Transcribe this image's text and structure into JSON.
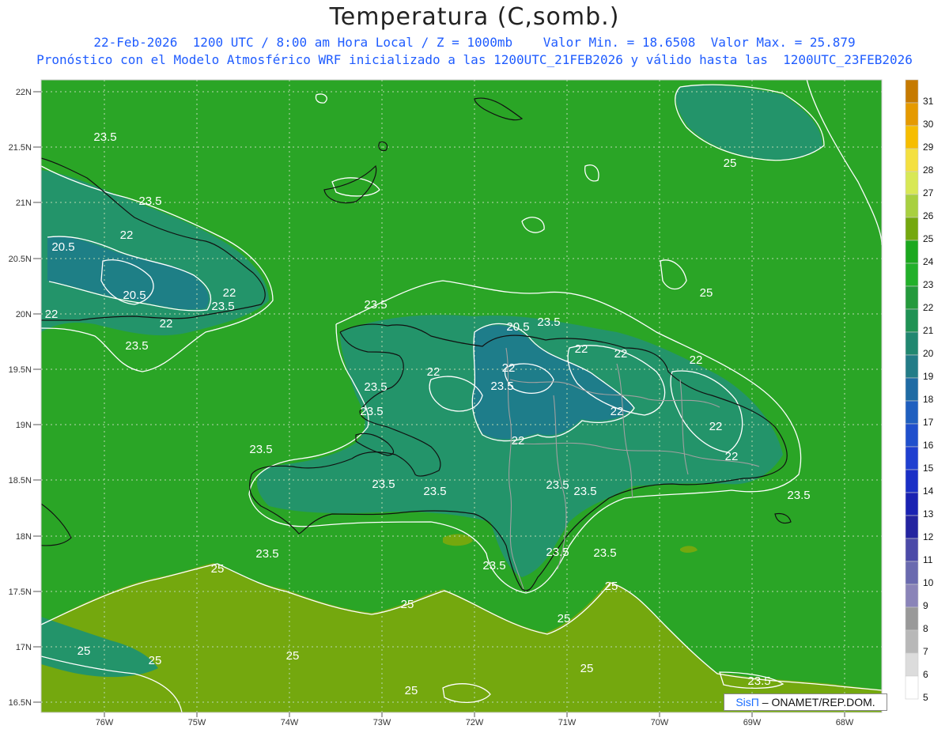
{
  "header": {
    "title": "Temperatura (C,somb.)",
    "line1": "22-Feb-2026  1200 UTC / 8:00 am Hora Local / Z = 1000mb    Valor Min. = 18.6508  Valor Max. = 25.879",
    "line2": "Pronóstico con el Modelo Atmosférico WRF inicializado a las 1200UTC_21FEB2026 y válido hasta las  1200UTC_23FEB2026"
  },
  "axes": {
    "lat_labels": [
      "22N",
      "21.5N",
      "21N",
      "20.5N",
      "20N",
      "19.5N",
      "19N",
      "18.5N",
      "18N",
      "17.5N",
      "17N",
      "16.5N"
    ],
    "lon_labels": [
      "76W",
      "75W",
      "74W",
      "73W",
      "72W",
      "71W",
      "70W",
      "69W",
      "68W"
    ]
  },
  "contour_labels": [
    "23.5",
    "23.5",
    "22",
    "20.5",
    "20.5",
    "22",
    "22",
    "23.5",
    "22",
    "23.5",
    "23.5",
    "20.5",
    "23.5",
    "22",
    "22",
    "22",
    "23.5",
    "22",
    "22",
    "23.5",
    "23.5",
    "22",
    "22",
    "22",
    "23.5",
    "22",
    "23.5",
    "23.5",
    "23.5",
    "23.5",
    "23.5",
    "23.5",
    "23.5",
    "23.5",
    "23.5",
    "25",
    "25",
    "25",
    "25",
    "25",
    "25",
    "25",
    "25",
    "23.5",
    "25",
    "25",
    "25"
  ],
  "colorbar": {
    "levels": [
      "31",
      "30",
      "29",
      "28",
      "27",
      "26",
      "25",
      "24",
      "23",
      "22",
      "21",
      "20",
      "19",
      "18",
      "17",
      "16",
      "15",
      "14",
      "13",
      "12",
      "11",
      "10",
      "9",
      "8",
      "7",
      "6",
      "5"
    ],
    "colors": [
      "#c67a00",
      "#e59a00",
      "#f6bd00",
      "#f4e040",
      "#d8e855",
      "#a8d040",
      "#74a80e",
      "#1ba81e",
      "#22b02a",
      "#249a3c",
      "#1f9254",
      "#218770",
      "#237c87",
      "#1f6ba4",
      "#1f5fbf",
      "#1f4fcc",
      "#1f3fd0",
      "#1a2fc6",
      "#1a22b2",
      "#2424a0",
      "#4b4aa8",
      "#6a6aaf",
      "#8a84b8",
      "#999999",
      "#b8b8b8",
      "#dcdcdc",
      "#ffffff"
    ]
  },
  "colors": {
    "base_green": "#2aa526",
    "high_olive": "#74a80e",
    "low_teal": "#1f8a6a",
    "title_blue": "#1f5cff"
  },
  "credit": {
    "brand": "SisΠ",
    "text": " –  ONAMET/REP.DOM."
  }
}
